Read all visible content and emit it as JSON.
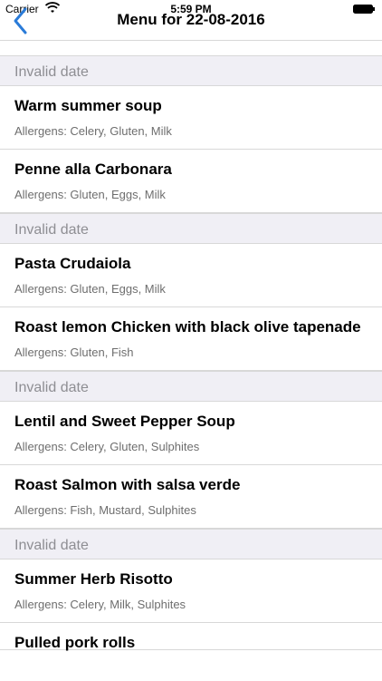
{
  "status_bar": {
    "carrier": "Carrier",
    "time": "5:59 PM"
  },
  "nav": {
    "title": "Menu for 22-08-2016",
    "back_icon": "chevron-left-icon",
    "accent_color": "#2a7bd8"
  },
  "sections": [
    {
      "header": "Invalid date",
      "items": [
        {
          "name": "Warm summer soup",
          "allergens": "Allergens: Celery, Gluten, Milk"
        },
        {
          "name": "Penne alla Carbonara",
          "allergens": "Allergens: Gluten, Eggs, Milk"
        }
      ]
    },
    {
      "header": "Invalid date",
      "items": [
        {
          "name": "Pasta Crudaiola",
          "allergens": "Allergens: Gluten, Eggs, Milk"
        },
        {
          "name": "Roast lemon Chicken with black olive tapenade",
          "allergens": "Allergens: Gluten, Fish"
        }
      ]
    },
    {
      "header": "Invalid date",
      "items": [
        {
          "name": "Lentil and Sweet Pepper Soup",
          "allergens": "Allergens: Celery, Gluten, Sulphites"
        },
        {
          "name": "Roast Salmon with salsa verde",
          "allergens": "Allergens: Fish, Mustard, Sulphites"
        }
      ]
    },
    {
      "header": "Invalid date",
      "items": [
        {
          "name": "Summer Herb Risotto",
          "allergens": "Allergens: Celery, Milk, Sulphites"
        },
        {
          "name": "Pulled pork rolls",
          "allergens": ""
        }
      ]
    }
  ]
}
